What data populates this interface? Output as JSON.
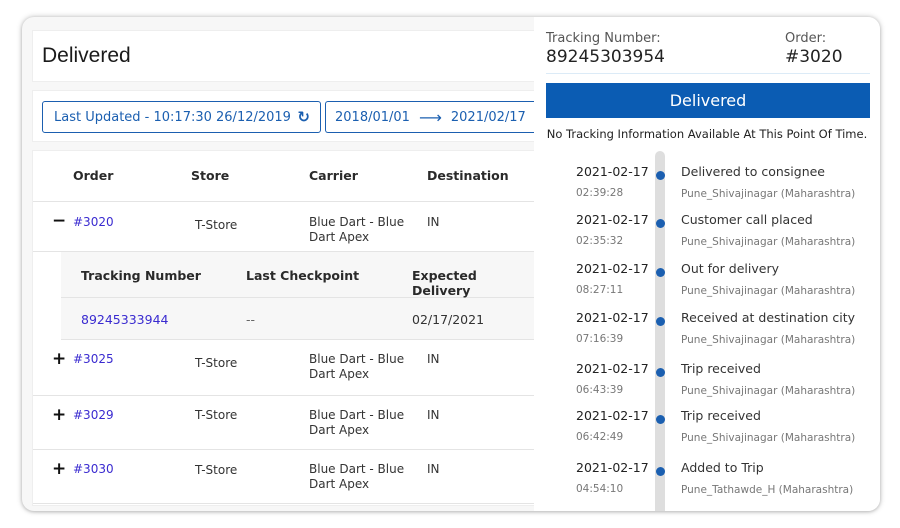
{
  "header": {
    "title": "Delivered"
  },
  "filters": {
    "last_updated_label": "Last Updated - 10:17:30 26/12/2019",
    "refresh_icon": "refresh-icon",
    "range_start": "2018/01/01",
    "range_arrow": "⟶",
    "range_end": "2021/02/17"
  },
  "table": {
    "columns": [
      "Order",
      "Store",
      "Carrier",
      "Destination"
    ],
    "rows": [
      {
        "toggle": "−",
        "order": "#3020",
        "store": "T-Store",
        "carrier": "Blue Dart - Blue Dart Apex",
        "destination": "IN",
        "expanded": true
      },
      {
        "toggle": "+",
        "order": "#3025",
        "store": "T-Store",
        "carrier": "Blue Dart - Blue Dart Apex",
        "destination": "IN",
        "expanded": false
      },
      {
        "toggle": "+",
        "order": "#3029",
        "store": "T-Store",
        "carrier": "Blue Dart - Blue Dart Apex",
        "destination": "IN",
        "expanded": false
      },
      {
        "toggle": "+",
        "order": "#3030",
        "store": "T-Store",
        "carrier": "Blue Dart - Blue Dart Apex",
        "destination": "IN",
        "expanded": false
      }
    ],
    "subtable": {
      "columns": [
        "Tracking Number",
        "Last Checkpoint",
        "Expected Delivery"
      ],
      "rows": [
        {
          "tracking_number": "89245333944",
          "last_checkpoint": "--",
          "expected_delivery": "02/17/2021"
        }
      ]
    }
  },
  "tracking_panel": {
    "tracking_label": "Tracking Number:",
    "tracking_value": "89245303954",
    "order_label": "Order:",
    "order_value": "#3020",
    "status": "Delivered",
    "status_color": "#0b5cb3",
    "notice": "No Tracking Information Available At This Point Of Time.",
    "events": [
      {
        "date": "2021-02-17",
        "time": "02:39:28",
        "description": "Delivered to consignee",
        "location": "Pune_Shivajinagar (Maharashtra)"
      },
      {
        "date": "2021-02-17",
        "time": "02:35:32",
        "description": "Customer call placed",
        "location": "Pune_Shivajinagar (Maharashtra)"
      },
      {
        "date": "2021-02-17",
        "time": "08:27:11",
        "description": "Out for delivery",
        "location": "Pune_Shivajinagar (Maharashtra)"
      },
      {
        "date": "2021-02-17",
        "time": "07:16:39",
        "description": "Received at destination city",
        "location": "Pune_Shivajinagar (Maharashtra)"
      },
      {
        "date": "2021-02-17",
        "time": "06:43:39",
        "description": "Trip received",
        "location": "Pune_Shivajinagar (Maharashtra)"
      },
      {
        "date": "2021-02-17",
        "time": "06:42:49",
        "description": "Trip received",
        "location": "Pune_Shivajinagar (Maharashtra)"
      },
      {
        "date": "2021-02-17",
        "time": "04:54:10",
        "description": "Added to Trip",
        "location": "Pune_Tathawde_H (Maharashtra)"
      }
    ]
  }
}
